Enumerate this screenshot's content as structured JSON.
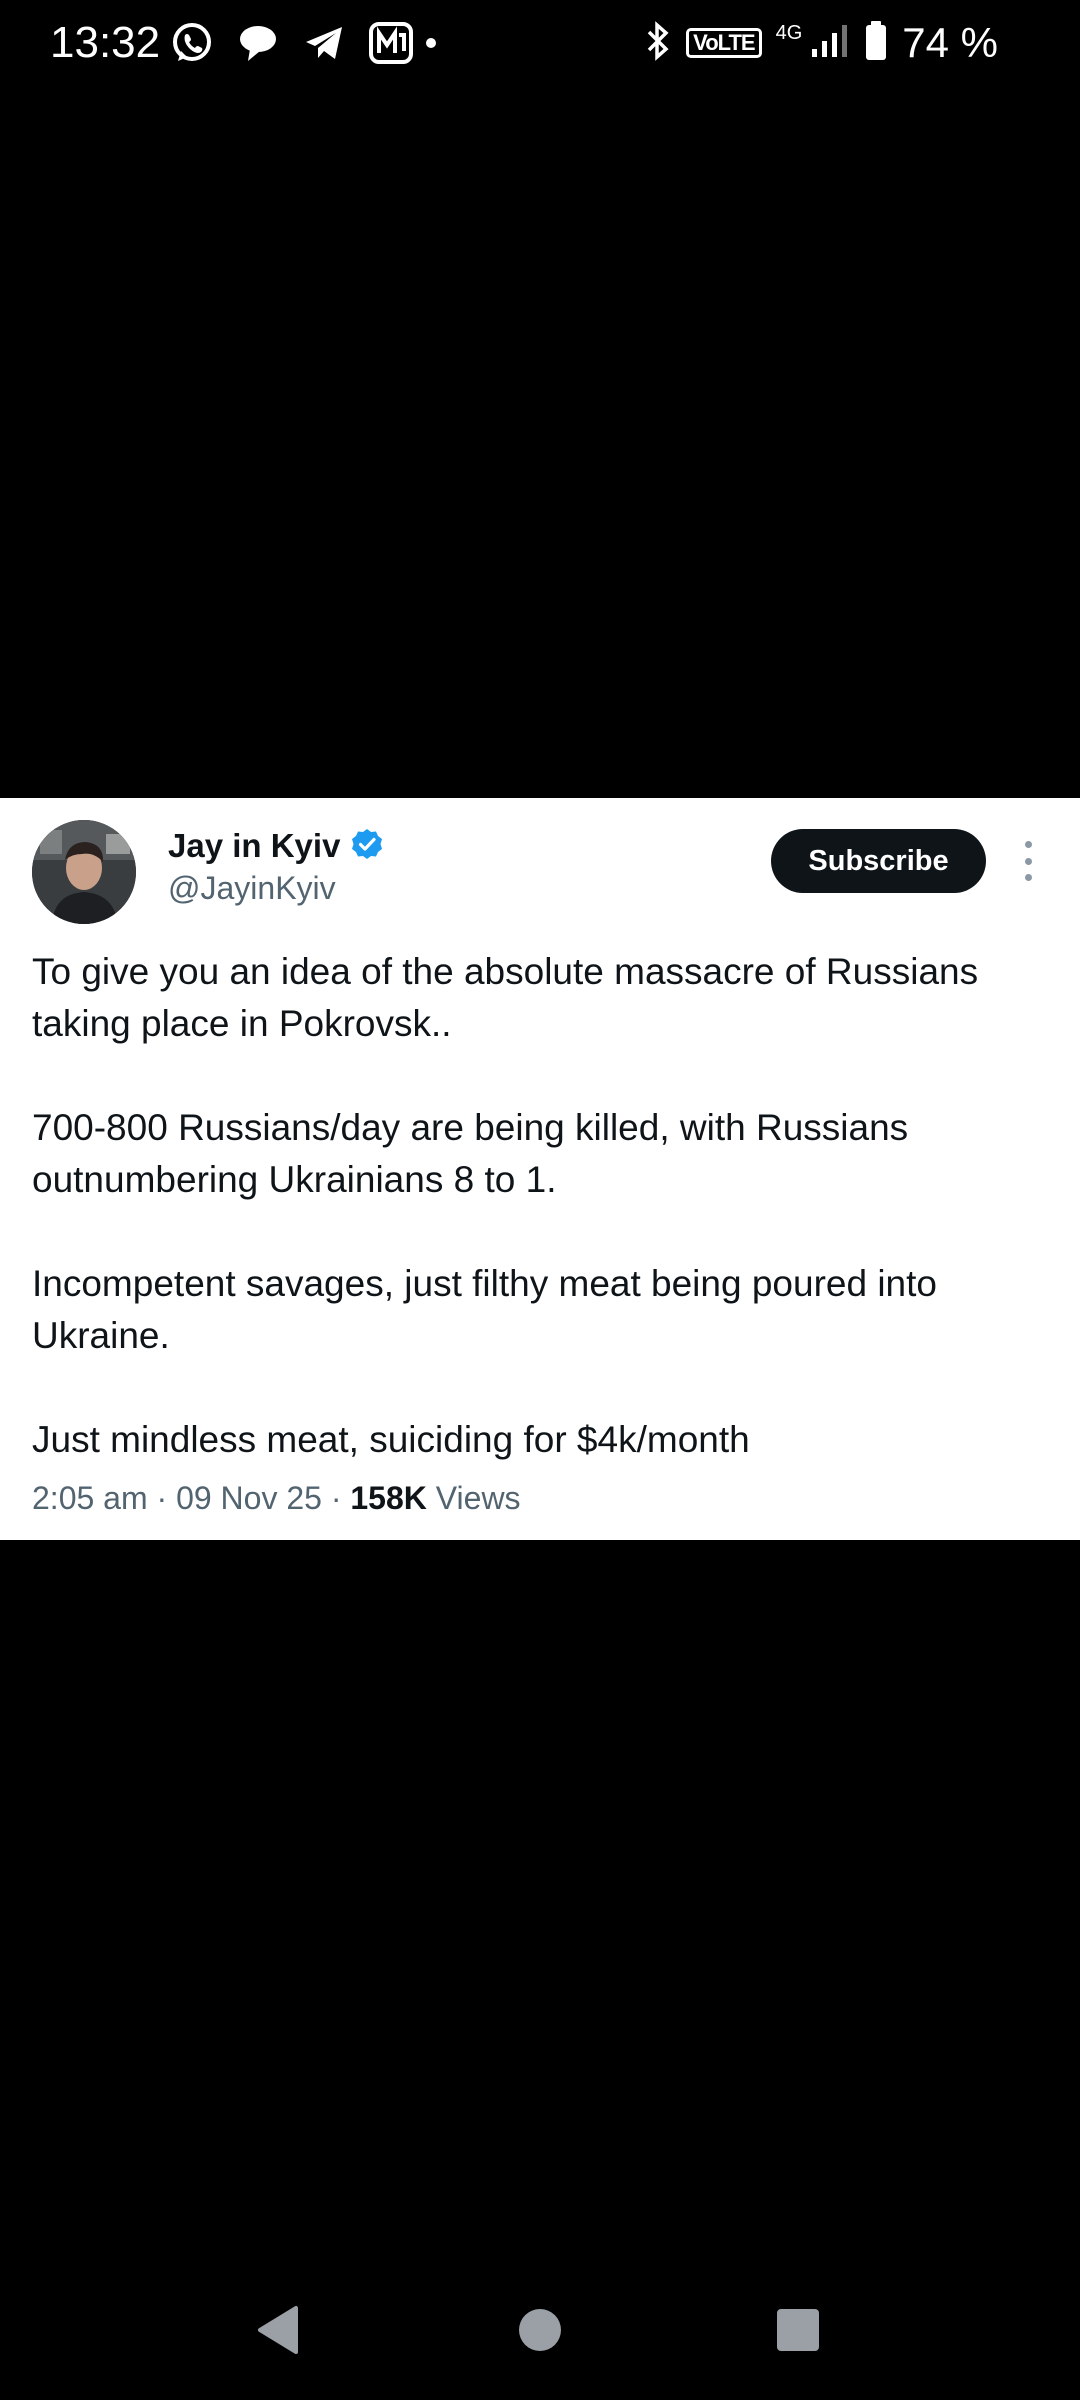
{
  "status_bar": {
    "time": "13:32",
    "left_icons": [
      "whatsapp-icon",
      "chat-bubble-icon",
      "telegram-icon",
      "app-notification-icon",
      "more-notifications-dot"
    ],
    "right_icons": [
      "bluetooth-icon",
      "volte-badge",
      "signal-icon",
      "battery-icon"
    ],
    "volte_label": "VoLTE",
    "network_type": "4G",
    "battery_percent": "74 %"
  },
  "tweet": {
    "author_name": "Jay in Kyiv",
    "author_handle": "@JayinKyiv",
    "verified": true,
    "subscribe_label": "Subscribe",
    "paragraphs": [
      "To give you an idea of the absolute massacre of Russians taking place in Pokrovsk..",
      "700-800 Russians/day are being killed, with Russians outnumbering Ukrainians 8 to 1.",
      "Incompetent savages, just filthy meat being poured into Ukraine.",
      "Just mindless meat, suiciding for $4k/month"
    ],
    "time": "2:05 am",
    "date": "09 Nov 25",
    "views_count": "158K",
    "views_label": "Views",
    "separator": "·"
  },
  "nav_bar": {
    "buttons": [
      "back",
      "home",
      "recents"
    ]
  },
  "colors": {
    "background": "#000000",
    "card_background": "#ffffff",
    "primary_text": "#0f1419",
    "secondary_text": "#536471",
    "verified_blue": "#1d9bf0",
    "subscribe_bg": "#0f1419"
  }
}
